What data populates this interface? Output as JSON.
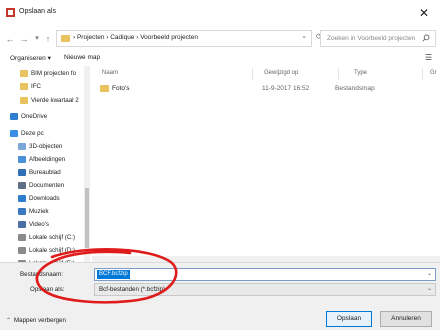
{
  "window": {
    "title": "Opslaan als",
    "close_label": "✕"
  },
  "address": {
    "path": "› Projecten › Cadique › Voorbeeld projecten",
    "search_placeholder": "Zoeken in Voorbeeld projecten"
  },
  "toolbar": {
    "organize_label": "Organiseren ▾",
    "new_folder_label": "Nieuwe map"
  },
  "nav": {
    "items": [
      {
        "label": "BIM projecten fo",
        "icon": "folder-icon"
      },
      {
        "label": "IFC",
        "icon": "folder-icon"
      },
      {
        "label": "Vierde kwartaal 2",
        "icon": "folder-icon"
      },
      {
        "label": "OneDrive",
        "icon": "cloud-icon"
      },
      {
        "label": "Deze pc",
        "icon": "computer-icon"
      },
      {
        "label": "3D-objecten",
        "icon": "cube-icon"
      },
      {
        "label": "Afbeeldingen",
        "icon": "pictures-icon"
      },
      {
        "label": "Bureaublad",
        "icon": "desktop-icon"
      },
      {
        "label": "Documenten",
        "icon": "documents-icon"
      },
      {
        "label": "Downloads",
        "icon": "download-icon"
      },
      {
        "label": "Muziek",
        "icon": "music-icon"
      },
      {
        "label": "Video's",
        "icon": "video-icon"
      },
      {
        "label": "Lokale schijf (C:)",
        "icon": "drive-icon"
      },
      {
        "label": "Lokale schijf (D:)",
        "icon": "drive-icon"
      },
      {
        "label": "Lokale schijf (E:)",
        "icon": "drive-icon"
      }
    ]
  },
  "content": {
    "columns": [
      "Naam",
      "Gewijzigd op",
      "Type",
      "Gr"
    ],
    "rows": [
      {
        "name": "Foto's",
        "modified": "11-9-2017 16:52",
        "type": "Bestandsmap"
      }
    ]
  },
  "form": {
    "filename_label": "Bestandsnaam:",
    "filename_value": "BCF.bcfzip",
    "filetype_label": "Opslaan als:",
    "filetype_value": "Bcf-bestanden (*.bcfzip)"
  },
  "footer": {
    "hide_folders_label": "Mappen verbergen",
    "save_label": "Opslaan",
    "cancel_label": "Annuleren"
  },
  "colors": {
    "accent": "#0078d7",
    "folder": "#e8c25c",
    "annotation": "#e01b1b"
  }
}
